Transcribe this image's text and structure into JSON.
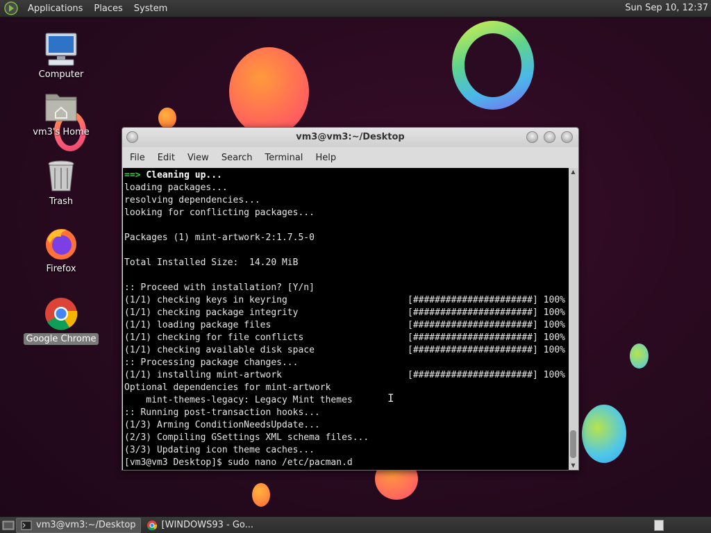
{
  "top_panel": {
    "menus": [
      "Applications",
      "Places",
      "System"
    ],
    "clock": "Sun Sep 10, 12:37"
  },
  "desktop_icons": [
    {
      "label": "Computer",
      "icon": "computer-icon"
    },
    {
      "label": "vm3's Home",
      "icon": "home-folder-icon"
    },
    {
      "label": "Trash",
      "icon": "trash-icon"
    },
    {
      "label": "Firefox",
      "icon": "firefox-icon"
    },
    {
      "label": "Google Chrome",
      "icon": "chrome-icon",
      "selected": true
    }
  ],
  "window": {
    "title": "vm3@vm3:~/Desktop",
    "menu": [
      "File",
      "Edit",
      "View",
      "Search",
      "Terminal",
      "Help"
    ]
  },
  "terminal": {
    "lines": [
      {
        "prefix": "==> ",
        "text": "Cleaning up...",
        "style": "heading"
      },
      {
        "text": "loading packages..."
      },
      {
        "text": "resolving dependencies..."
      },
      {
        "text": "looking for conflicting packages..."
      },
      {
        "text": ""
      },
      {
        "text": "Packages (1) mint-artwork-2:1.7.5-0"
      },
      {
        "text": ""
      },
      {
        "text": "Total Installed Size:  14.20 MiB"
      },
      {
        "text": ""
      },
      {
        "text": ":: Proceed with installation? [Y/n]"
      },
      {
        "text": "(1/1) checking keys in keyring",
        "progress": "[######################] 100%"
      },
      {
        "text": "(1/1) checking package integrity",
        "progress": "[######################] 100%"
      },
      {
        "text": "(1/1) loading package files",
        "progress": "[######################] 100%"
      },
      {
        "text": "(1/1) checking for file conflicts",
        "progress": "[######################] 100%"
      },
      {
        "text": "(1/1) checking available disk space",
        "progress": "[######################] 100%"
      },
      {
        "text": ":: Processing package changes..."
      },
      {
        "text": "(1/1) installing mint-artwork",
        "progress": "[######################] 100%"
      },
      {
        "text": "Optional dependencies for mint-artwork"
      },
      {
        "text": "    mint-themes-legacy: Legacy Mint themes"
      },
      {
        "text": ":: Running post-transaction hooks..."
      },
      {
        "text": "(1/3) Arming ConditionNeedsUpdate..."
      },
      {
        "text": "(2/3) Compiling GSettings XML schema files..."
      },
      {
        "text": "(3/3) Updating icon theme caches..."
      },
      {
        "text": "[vm3@vm3 Desktop]$ sudo nano /etc/pacman.d"
      }
    ]
  },
  "taskbar": {
    "tasks": [
      {
        "label": "vm3@vm3:~/Desktop",
        "icon": "terminal-icon",
        "active": true
      },
      {
        "label": "[WINDOWS93 - Go...",
        "icon": "chrome-icon",
        "active": false
      }
    ]
  }
}
